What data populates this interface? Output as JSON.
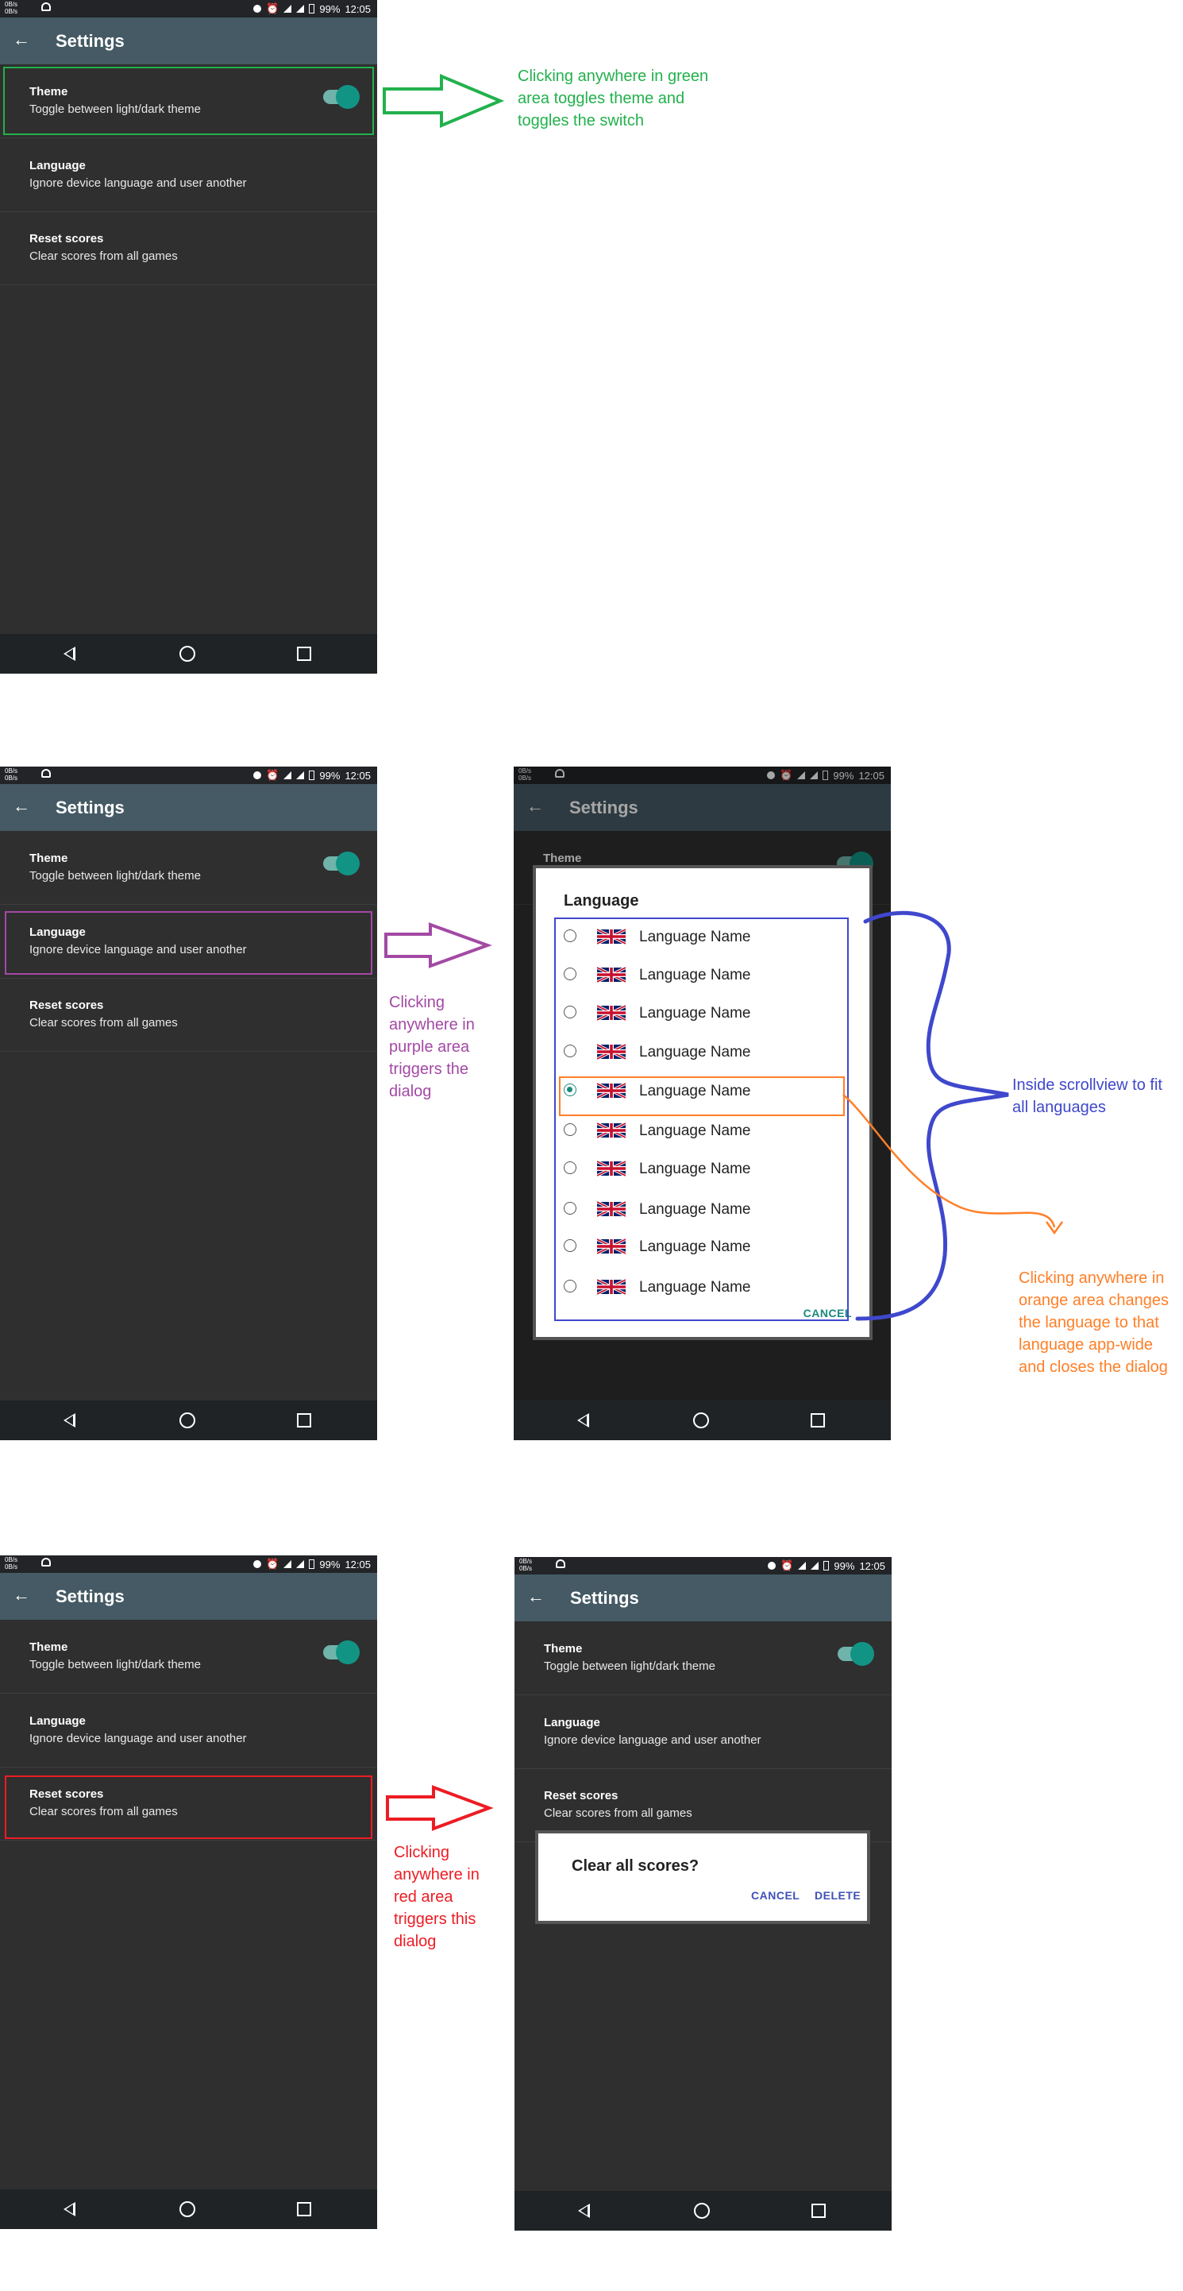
{
  "status_bar": {
    "speed": "0B/s\n0B/s",
    "battery": "99%",
    "time": "12:05"
  },
  "app_bar": {
    "title": "Settings",
    "back_glyph": "←"
  },
  "prefs": {
    "theme_title": "Theme",
    "theme_summary": "Toggle between light/dark theme",
    "language_title": "Language",
    "language_summary": "Ignore device language and user another",
    "reset_title": "Reset scores",
    "reset_summary": "Clear scores from all games"
  },
  "annotations": {
    "green": "Clicking anywhere in green area toggles theme and toggles the switch",
    "purple": "Clicking anywhere in purple area triggers the dialog",
    "blue": "Inside scrollview to fit all languages",
    "orange": "Clicking anywhere in orange area changes the language to that language app-wide and closes the dialog",
    "red": "Clicking anywhere in red area triggers this dialog"
  },
  "language_dialog": {
    "title": "Language",
    "languages": [
      "Language Name",
      "Language Name",
      "Language Name",
      "Language Name",
      "Language Name",
      "Language Name",
      "Language Name",
      "Language Name",
      "Language Name",
      "Language Name"
    ],
    "selected_index": 4,
    "cancel": "CANCEL"
  },
  "reset_dialog": {
    "title": "Clear all scores?",
    "cancel": "CANCEL",
    "delete": "DELETE"
  },
  "colors": {
    "green": "#22b14c",
    "purple": "#a349a4",
    "blue": "#3f48cc",
    "orange": "#ff7f27",
    "red": "#ed1c24",
    "toolbar": "#455a64",
    "accent": "#129485"
  }
}
